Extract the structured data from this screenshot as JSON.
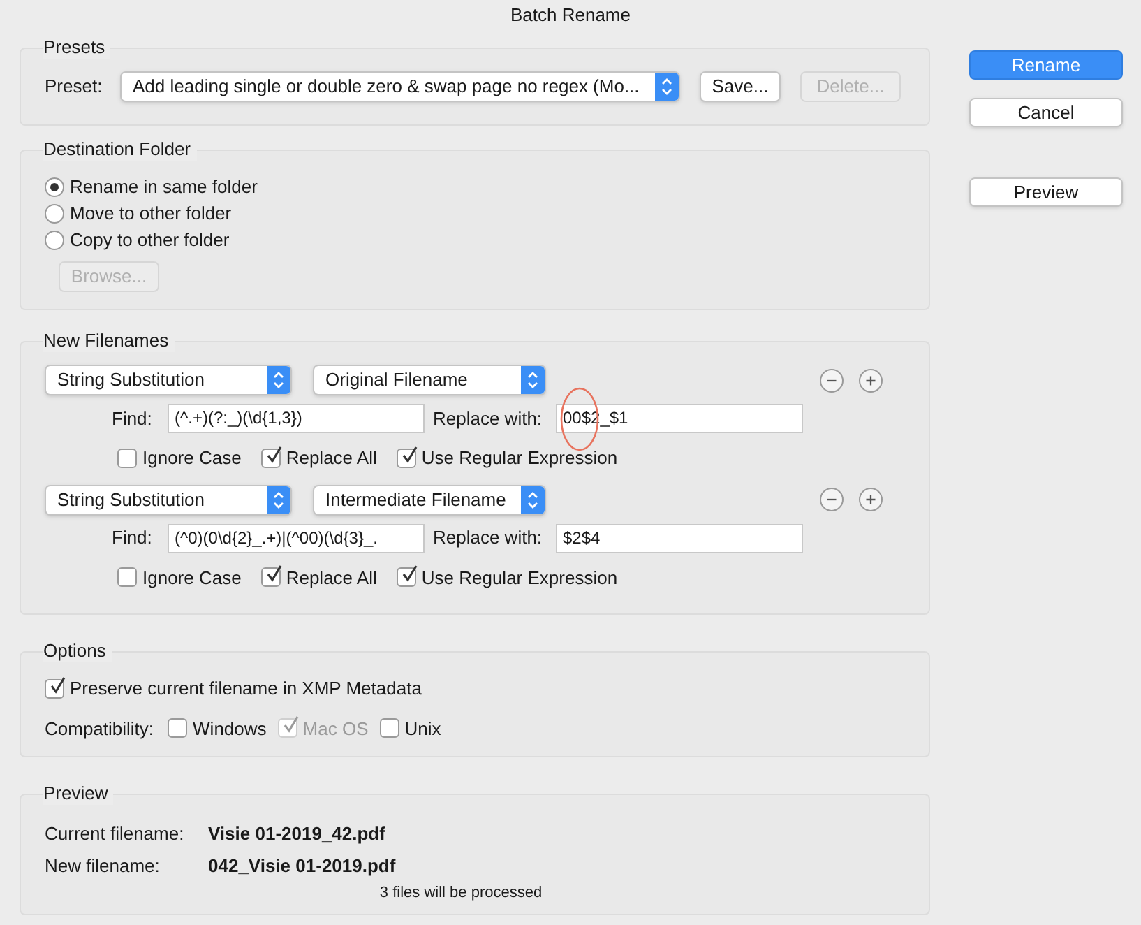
{
  "window": {
    "title": "Batch Rename"
  },
  "presets": {
    "heading": "Presets",
    "label": "Preset:",
    "value": "Add leading single or double zero & swap page no regex (Mo...",
    "buttons": [
      {
        "label": "Save...",
        "disabled": false
      },
      {
        "label": "Delete...",
        "disabled": true
      }
    ]
  },
  "destination": {
    "heading": "Destination Folder",
    "options": [
      {
        "label": "Rename in same folder",
        "selected": true
      },
      {
        "label": "Move to other folder",
        "selected": false
      },
      {
        "label": "Copy to other folder",
        "selected": false
      }
    ],
    "browse": {
      "label": "Browse...",
      "disabled": true
    }
  },
  "new_filenames": {
    "heading": "New Filenames",
    "rules": [
      {
        "method": "String Substitution",
        "source": "Original Filename",
        "find_label": "Find:",
        "find": "(^.+)(?:_)(\\d{1,3})",
        "replace_label": "Replace with:",
        "replace": "00$2_$1",
        "annotated": true,
        "options": [
          {
            "label": "Ignore Case",
            "checked": false
          },
          {
            "label": "Replace All",
            "checked": true
          },
          {
            "label": "Use Regular Expression",
            "checked": true
          }
        ]
      },
      {
        "method": "String Substitution",
        "source": "Intermediate Filename",
        "find_label": "Find:",
        "find": "(^0)(0\\d{2}_.+)|(^00)(\\d{3}_.",
        "replace_label": "Replace with:",
        "replace": "$2$4",
        "annotated": false,
        "options": [
          {
            "label": "Ignore Case",
            "checked": false
          },
          {
            "label": "Replace All",
            "checked": true
          },
          {
            "label": "Use Regular Expression",
            "checked": true
          }
        ]
      }
    ]
  },
  "options": {
    "heading": "Options",
    "preserve": {
      "label": "Preserve current filename in XMP Metadata",
      "checked": true
    },
    "compat_label": "Compatibility:",
    "compatibility": [
      {
        "label": "Windows",
        "checked": false,
        "disabled": false
      },
      {
        "label": "Mac OS",
        "checked": true,
        "disabled": true
      },
      {
        "label": "Unix",
        "checked": false,
        "disabled": false
      }
    ]
  },
  "preview": {
    "heading": "Preview",
    "rows": [
      {
        "label": "Current filename:",
        "value": "Visie 01-2019_42.pdf"
      },
      {
        "label": "New filename:",
        "value": "042_Visie 01-2019.pdf"
      }
    ],
    "summary": "3 files will be processed"
  },
  "actions": [
    {
      "label": "Rename",
      "primary": true
    },
    {
      "label": "Cancel",
      "primary": false
    },
    {
      "label": "Preview",
      "primary": false
    }
  ]
}
